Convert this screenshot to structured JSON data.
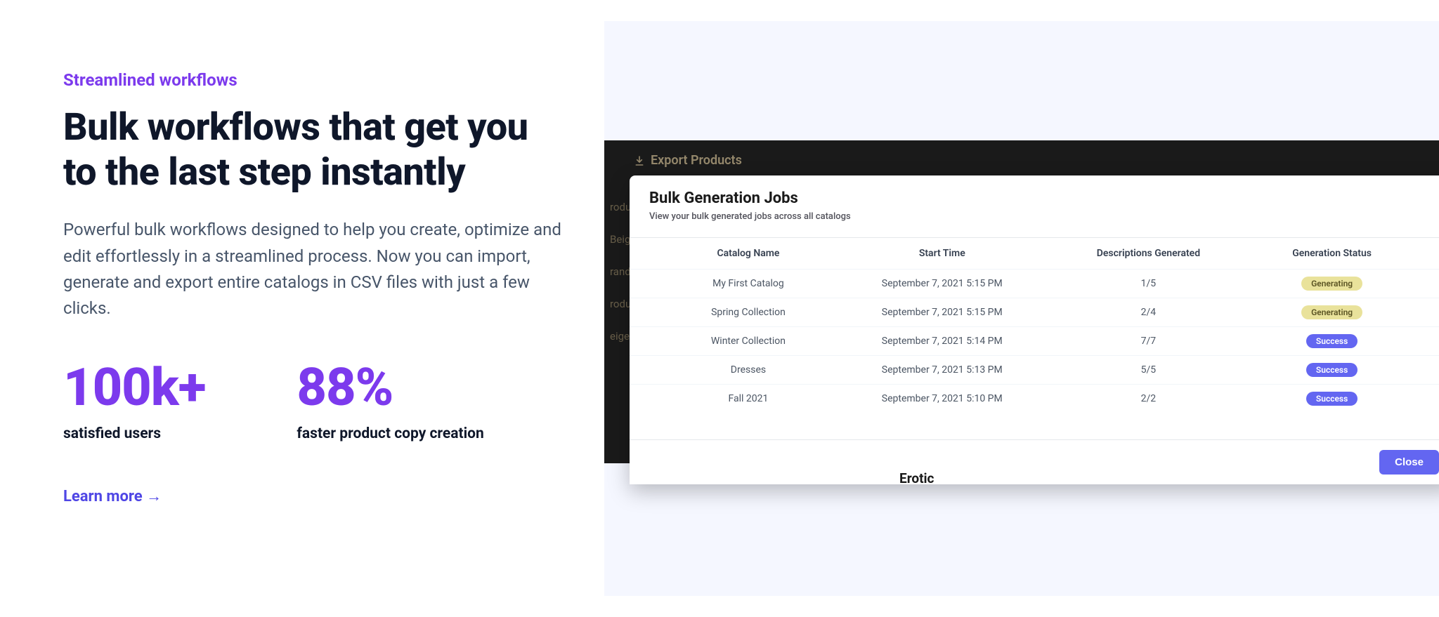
{
  "left": {
    "eyebrow": "Streamlined workflows",
    "headline": "Bulk workflows that get you to the last step instantly",
    "body": "Powerful bulk workflows designed to help you create, optimize and edit effortlessly in a streamlined process. Now you can import, generate and export entire catalogs in CSV files with just a few clicks.",
    "stats": [
      {
        "value": "100k+",
        "label": "satisfied users"
      },
      {
        "value": "88%",
        "label": "faster product copy creation"
      }
    ],
    "learn_more": "Learn more →"
  },
  "app": {
    "tab_label": "Export Products",
    "bg_fragments": [
      "roduct",
      "Beige",
      "rand",
      "roduct",
      "eige"
    ],
    "peek_label": "Erotic"
  },
  "modal": {
    "title": "Bulk Generation Jobs",
    "subtitle": "View your bulk generated jobs across all catalogs",
    "columns": [
      "Catalog Name",
      "Start Time",
      "Descriptions Generated",
      "Generation Status"
    ],
    "rows": [
      {
        "name": "My First Catalog",
        "time": "September 7, 2021 5:15 PM",
        "desc": "1/5",
        "status": "Generating"
      },
      {
        "name": "Spring Collection",
        "time": "September 7, 2021 5:15 PM",
        "desc": "2/4",
        "status": "Generating"
      },
      {
        "name": "Winter Collection",
        "time": "September 7, 2021 5:14 PM",
        "desc": "7/7",
        "status": "Success"
      },
      {
        "name": "Dresses",
        "time": "September 7, 2021 5:13 PM",
        "desc": "5/5",
        "status": "Success"
      },
      {
        "name": "Fall 2021",
        "time": "September 7, 2021 5:10 PM",
        "desc": "2/2",
        "status": "Success"
      }
    ],
    "close": "Close"
  }
}
